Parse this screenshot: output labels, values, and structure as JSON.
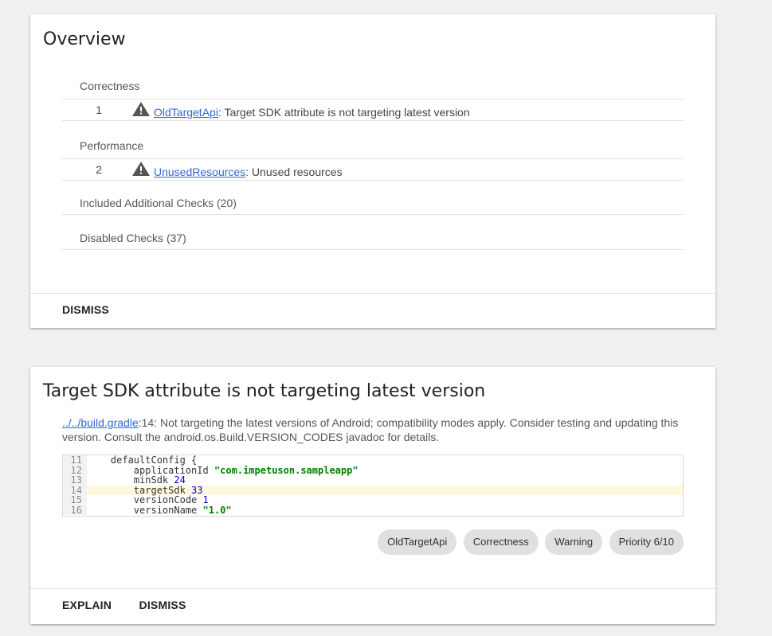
{
  "overview": {
    "title": "Overview",
    "categories": [
      {
        "name": "Correctness",
        "issues": [
          {
            "count": "1",
            "id": "OldTargetApi",
            "summary": ": Target SDK attribute is not targeting latest version"
          }
        ]
      },
      {
        "name": "Performance",
        "issues": [
          {
            "count": "2",
            "id": "UnusedResources",
            "summary": ": Unused resources"
          }
        ]
      }
    ],
    "included_checks": "Included Additional Checks (20)",
    "disabled_checks": "Disabled Checks (37)",
    "dismiss_label": "DISMISS"
  },
  "issue": {
    "title": "Target SDK attribute is not targeting latest version",
    "file_link": "../../build.gradle",
    "file_line": ":14",
    "message": ": Not targeting the latest versions of Android; compatibility modes apply. Consider testing and updating this version. Consult the android.os.Build.VERSION_CODES javadoc for details.",
    "code": [
      {
        "line": "11",
        "text": "    defaultConfig {"
      },
      {
        "line": "12",
        "text": "        applicationId ",
        "str": "\"com.impetuson.sampleapp\""
      },
      {
        "line": "13",
        "text": "        minSdk ",
        "num": "24"
      },
      {
        "line": "14",
        "text": "        targetSdk ",
        "num": "33",
        "highlight": true
      },
      {
        "line": "15",
        "text": "        versionCode ",
        "num": "1"
      },
      {
        "line": "16",
        "text": "        versionName ",
        "str": "\"1.0\""
      }
    ],
    "chips": [
      "OldTargetApi",
      "Correctness",
      "Warning",
      "Priority 6/10"
    ],
    "explain_label": "EXPLAIN",
    "dismiss_label": "DISMISS"
  },
  "colors": {
    "link": "#3367d6",
    "highlight": "#fff8dc",
    "chip_bg": "#e0e0e0",
    "string": "#008000",
    "number": "#0000cc"
  },
  "icons": {
    "warning": "warning-icon"
  }
}
